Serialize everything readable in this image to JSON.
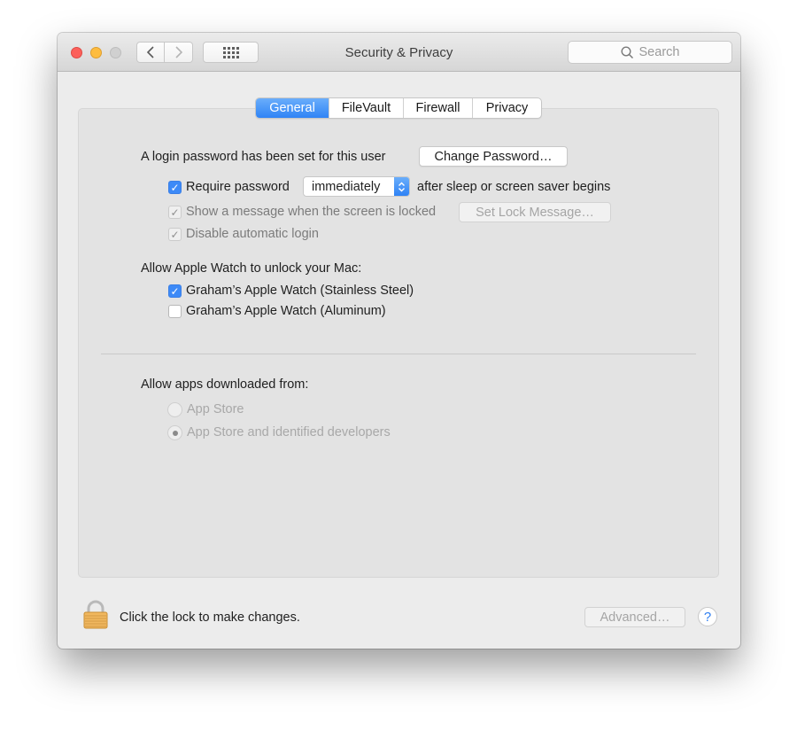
{
  "window": {
    "title": "Security & Privacy",
    "search_placeholder": "Search",
    "traffic_lights": [
      "close",
      "minimize",
      "zoom"
    ],
    "nav": {
      "back_icon": "chevron-left-icon",
      "forward_icon": "chevron-right-icon",
      "grid_icon": "show-all-grid-icon"
    }
  },
  "tabs": [
    {
      "label": "General",
      "active": true
    },
    {
      "label": "FileVault",
      "active": false
    },
    {
      "label": "Firewall",
      "active": false
    },
    {
      "label": "Privacy",
      "active": false
    }
  ],
  "general": {
    "login_password_text": "A login password has been set for this user",
    "change_password_label": "Change Password…",
    "require_password": {
      "label": "Require password",
      "checked": true,
      "selected": "immediately",
      "suffix": "after sleep or screen saver begins"
    },
    "show_message": {
      "label": "Show a message when the screen is locked",
      "checked": true,
      "enabled": false,
      "button_label": "Set Lock Message…"
    },
    "disable_auto_login": {
      "label": "Disable automatic login",
      "checked": true,
      "enabled": false
    },
    "apple_watch": {
      "heading": "Allow Apple Watch to unlock your Mac:",
      "items": [
        {
          "label": "Graham’s Apple Watch (Stainless Steel)",
          "checked": true
        },
        {
          "label": "Graham’s Apple Watch (Aluminum)",
          "checked": false
        }
      ]
    },
    "downloads": {
      "heading": "Allow apps downloaded from:",
      "options": [
        {
          "label": "App Store",
          "selected": false
        },
        {
          "label": "App Store and identified developers",
          "selected": true
        }
      ]
    }
  },
  "footer": {
    "lock_text": "Click the lock to make changes.",
    "advanced_label": "Advanced…",
    "help_label": "?"
  },
  "colors": {
    "accent": "#3d8af7",
    "close": "#fc605b",
    "minimize": "#fdbc40"
  }
}
